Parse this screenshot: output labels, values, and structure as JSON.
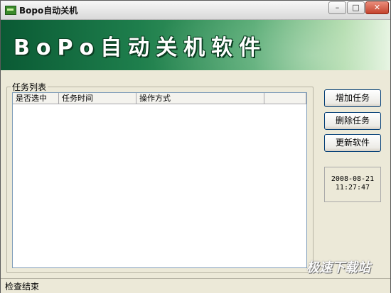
{
  "window": {
    "title": "Bopo自动关机",
    "minimize_glyph": "–",
    "maximize_glyph": "□",
    "close_glyph": "✕"
  },
  "banner": {
    "title": "BoPo自动关机软件"
  },
  "task_list": {
    "group_label": "任务列表",
    "columns": [
      "是否选中",
      "任务时间",
      "操作方式",
      ""
    ],
    "rows": []
  },
  "buttons": {
    "add": "增加任务",
    "delete": "删除任务",
    "update": "更新软件"
  },
  "clock": {
    "date": "2008-08-21",
    "time": "11:27:47"
  },
  "status": {
    "text": "检查结束"
  },
  "watermark": {
    "text": "极速下载站"
  },
  "colors": {
    "banner_dark": "#0a5a34",
    "banner_light": "#e4f3df",
    "window_bg": "#ece9d8",
    "close_button": "#c4442e"
  },
  "icons": {
    "app": "app-icon",
    "minimize": "minimize-icon",
    "maximize": "maximize-icon",
    "close": "close-icon"
  }
}
